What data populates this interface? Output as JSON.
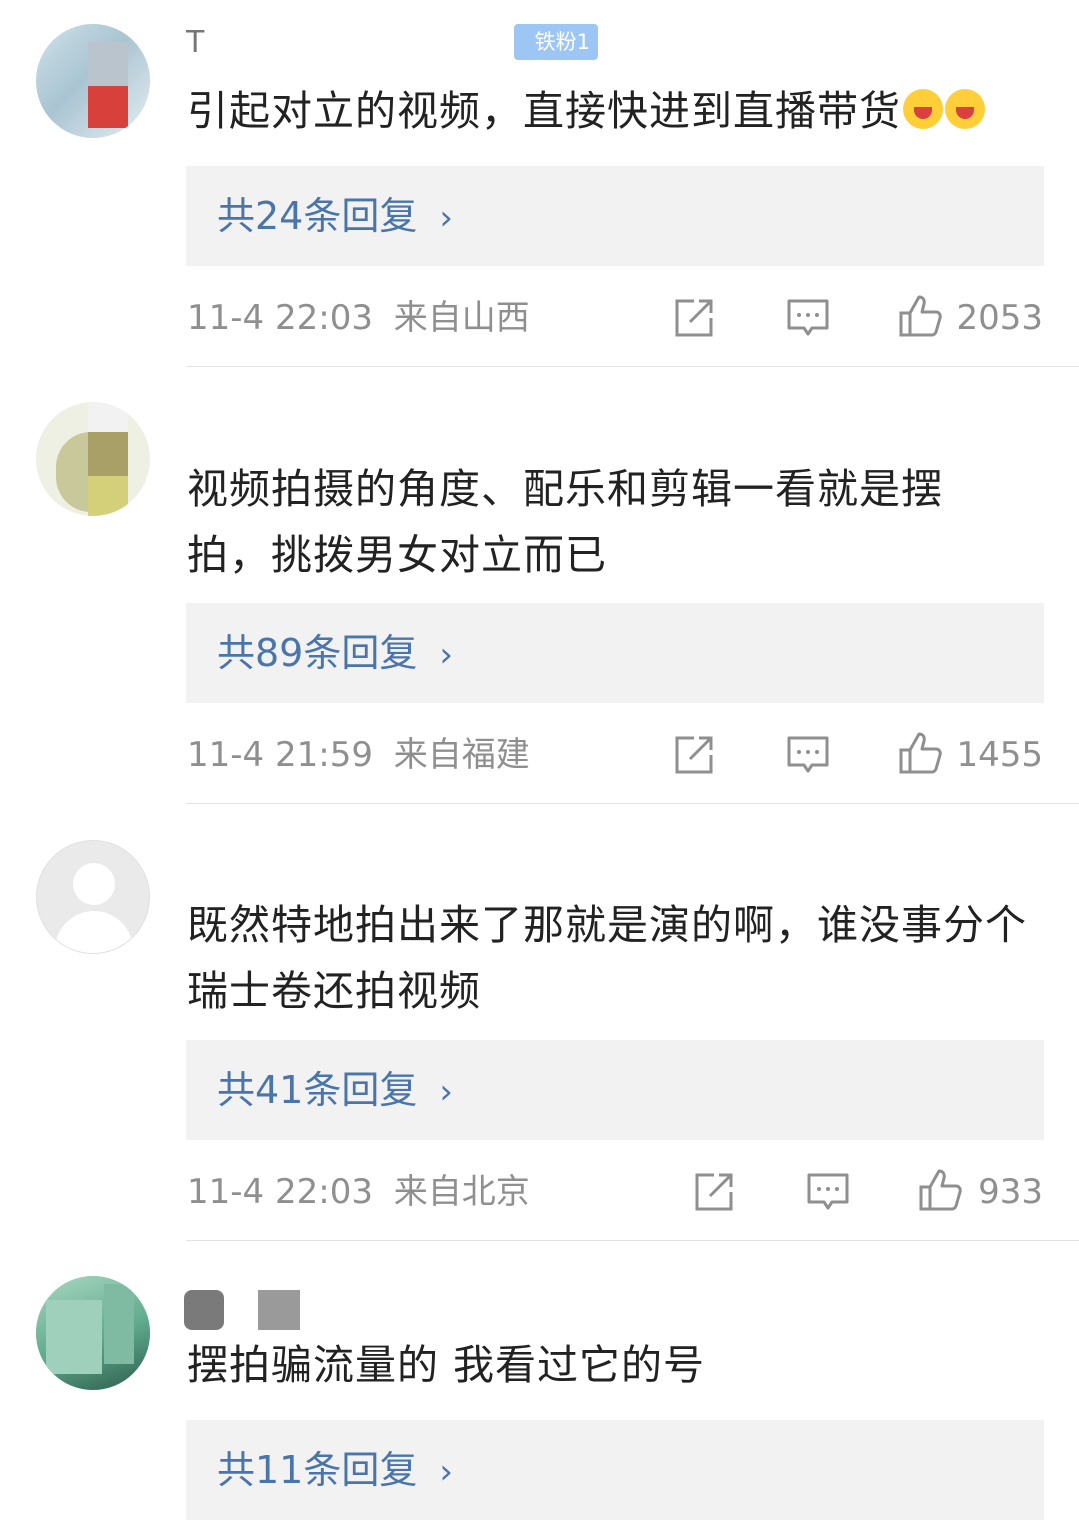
{
  "comments": [
    {
      "username": "T",
      "fan_badge": "铁粉1",
      "text": "引起对立的视频，直接快进到直播带货",
      "emojis": [
        "laugh-cry-emoji",
        "laugh-cry-emoji"
      ],
      "replies_label": "共24条回复",
      "time": "11-4 22:03",
      "location": "来自山西",
      "likes": "2053"
    },
    {
      "username": "",
      "text": "视频拍摄的角度、配乐和剪辑一看就是摆拍，挑拨男女对立而已",
      "replies_label": "共89条回复",
      "time": "11-4 21:59",
      "location": "来自福建",
      "likes": "1455"
    },
    {
      "username": "",
      "text": "既然特地拍出来了那就是演的啊，谁没事分个瑞士卷还拍视频",
      "replies_label": "共41条回复",
      "time": "11-4 22:03",
      "location": "来自北京",
      "likes": "933"
    },
    {
      "username": "",
      "text": "摆拍骗流量的 我看过它的号",
      "replies_label": "共11条回复"
    }
  ],
  "icons": {
    "share": "share-icon",
    "comment": "comment-icon",
    "like": "thumbs-up-icon",
    "chevron": "chevron-right-icon",
    "chevron_glyph": "›"
  },
  "colors": {
    "link": "#4a75ac",
    "meta": "#8f8f8f",
    "reply_bg": "#f2f2f2",
    "badge": "#9ec6f5"
  }
}
